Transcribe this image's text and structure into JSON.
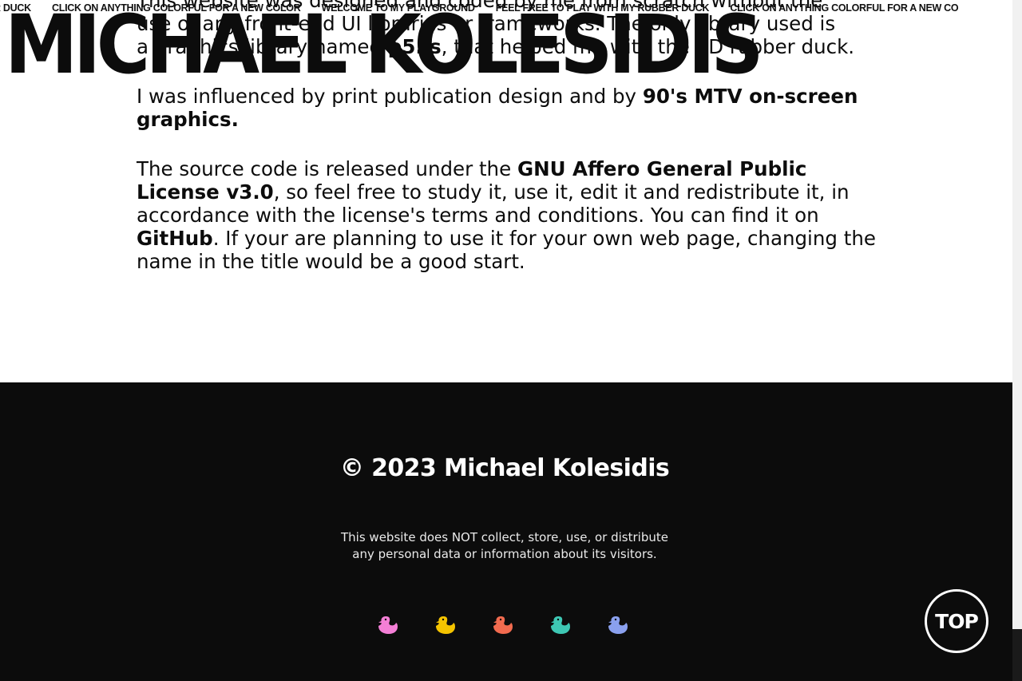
{
  "marquee": {
    "items": [
      "R DUCK",
      "CLICK ON ANYTHING COLORFUL FOR A NEW COLOR",
      "WELCOME TO MY PLAYGROUND",
      "FEEL FREE TO PLAY WITH MY RUBBER DUCK",
      "CLICK ON ANYTHING COLORFUL FOR A NEW CO"
    ]
  },
  "header": {
    "name": "MICHAEL KOLESIDIS"
  },
  "about": {
    "p1_line1": "This website was designed and coded by me from scratch without the",
    "p1_line2": "use of any front-end UI libraries or frameworks. The only library used is",
    "p1_line3a": "a graphics library named ",
    "p1_link": "p5.js",
    "p1_line3b": ", that helped me with the 3D rubber duck.",
    "p2_text": "I was influenced by print publication design and by ",
    "p2_bold": "90's MTV on-screen graphics.",
    "p3_text_a": "The source code is released under the ",
    "p3_bold_a": "GNU Affero General Public License v3.0",
    "p3_text_b": ", so feel free to study it, use it, edit it and redistribute it, in accordance with the license's terms and conditions. You can find it on ",
    "p3_bold_b": "GitHub",
    "p3_text_c": ". If your are planning to use it for your own web page, changing the name in the title would be a good start."
  },
  "footer": {
    "copyright": "© 2023 Michael Kolesidis",
    "privacy_line1": "This website does NOT collect, store, use, or distribute",
    "privacy_line2": "any personal data or information about its visitors.",
    "ducks": [
      {
        "icon": "duck-icon",
        "color": "#f47fd6"
      },
      {
        "icon": "duck-icon",
        "color": "#f5c400"
      },
      {
        "icon": "duck-icon",
        "color": "#f26b4f"
      },
      {
        "icon": "duck-icon",
        "color": "#3ec8b4"
      },
      {
        "icon": "duck-icon",
        "color": "#8aa0ee"
      }
    ],
    "top_label": "TOP"
  },
  "colors": {
    "background": "#ffffff",
    "footer_bg": "#0c0c0c",
    "text": "#0c0c0c",
    "footer_text": "#ffffff"
  }
}
